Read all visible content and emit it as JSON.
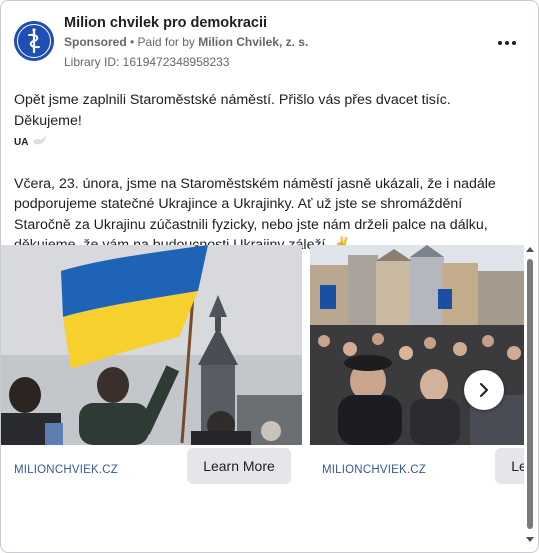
{
  "advertiser": {
    "name": "Milion chvilek pro demokracii",
    "sponsored_label": "Sponsored",
    "paid_for_prefix": "• Paid for by",
    "payer": "Milion Chvilek, z. s.",
    "library_id": "Library ID: 1619472348958233"
  },
  "post": {
    "line1": "Opět jsme zaplnili Staroměstské náměstí. Přišlo vás přes dvacet tisíc. Děkujeme!",
    "ua_tag": "UA",
    "paragraph2": "Včera, 23. února, jsme na Staroměstském náměstí jasně ukázali, že i nadále podporujeme statečné Ukrajince a Ukrajinky. Ať už jste se shromáždění Staročně za Ukrajinu zúčastnili fyzicky, nebo jste nám drželi palce na dálku, děkujeme, že vám na budoucnosti Ukrajiny záleží. ✌",
    "ellipsis": " …"
  },
  "carousel": {
    "cards": [
      {
        "domain": "MILIONCHVIEK.CZ",
        "cta": "Learn More"
      },
      {
        "domain": "MILIONCHVIEK.CZ",
        "cta": "Learn More"
      }
    ]
  },
  "icons": {
    "more": "more-options-icon",
    "next": "chevron-right-icon",
    "dove": "dove-icon"
  },
  "colors": {
    "link": "#385898",
    "secondary_text": "#65676b",
    "button_bg": "#e4e6eb",
    "avatar_bg": "#1f4fb4"
  }
}
